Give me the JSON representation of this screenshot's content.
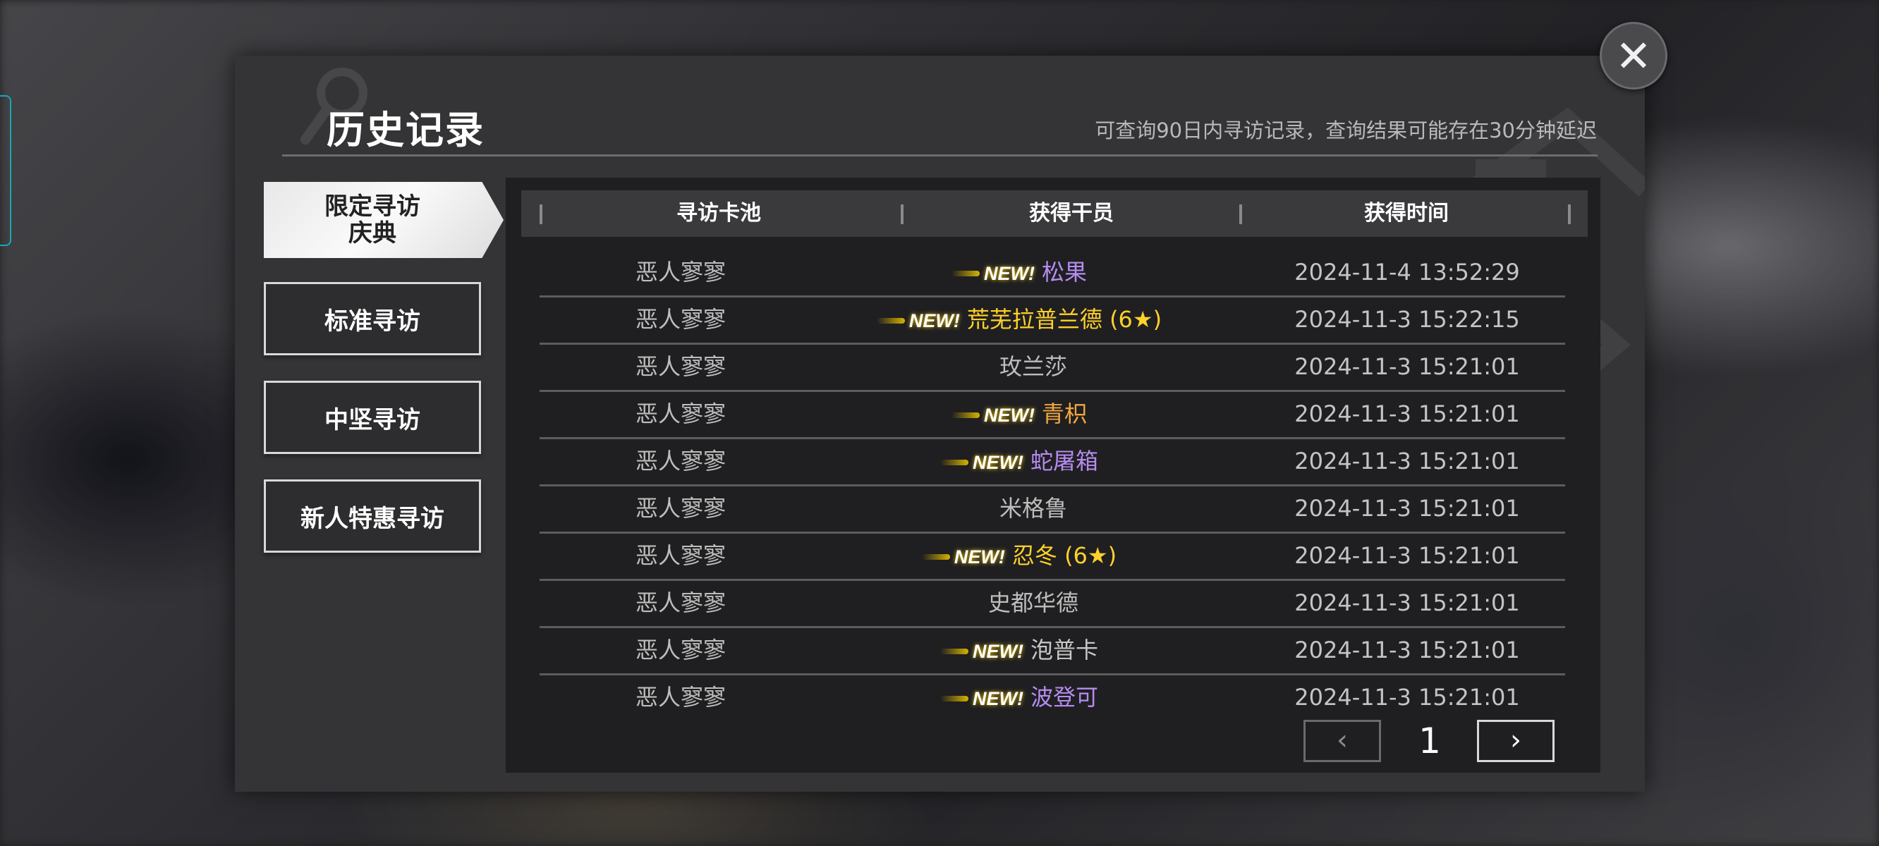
{
  "title": "历史记录",
  "subtitle": "可查询90日内寻访记录，查询结果可能存在30分钟延迟",
  "close_icon": "close-icon",
  "tabs": [
    {
      "label": "限定寻访\n庆典",
      "active": true
    },
    {
      "label": "标准寻访",
      "active": false
    },
    {
      "label": "中坚寻访",
      "active": false
    },
    {
      "label": "新人特惠寻访",
      "active": false
    }
  ],
  "table": {
    "headers": [
      "寻访卡池",
      "获得干员",
      "获得时间"
    ],
    "new_label": "NEW!",
    "rows": [
      {
        "pool": "恶人寥寥",
        "is_new": true,
        "operator": "松果",
        "color": "#b58cf0",
        "time": "2024-11-4 13:52:29"
      },
      {
        "pool": "恶人寥寥",
        "is_new": true,
        "operator": "荒芜拉普兰德 (6★)",
        "color": "#ffd12a",
        "time": "2024-11-3 15:22:15"
      },
      {
        "pool": "恶人寥寥",
        "is_new": false,
        "operator": "玫兰莎",
        "color": "#bdbdbd",
        "time": "2024-11-3 15:21:01"
      },
      {
        "pool": "恶人寥寥",
        "is_new": true,
        "operator": "青枳",
        "color": "#f2a640",
        "time": "2024-11-3 15:21:01"
      },
      {
        "pool": "恶人寥寥",
        "is_new": true,
        "operator": "蛇屠箱",
        "color": "#b58cf0",
        "time": "2024-11-3 15:21:01"
      },
      {
        "pool": "恶人寥寥",
        "is_new": false,
        "operator": "米格鲁",
        "color": "#bdbdbd",
        "time": "2024-11-3 15:21:01"
      },
      {
        "pool": "恶人寥寥",
        "is_new": true,
        "operator": "忍冬 (6★)",
        "color": "#ffd12a",
        "time": "2024-11-3 15:21:01"
      },
      {
        "pool": "恶人寥寥",
        "is_new": false,
        "operator": "史都华德",
        "color": "#bdbdbd",
        "time": "2024-11-3 15:21:01"
      },
      {
        "pool": "恶人寥寥",
        "is_new": true,
        "operator": "泡普卡",
        "color": "#c8c8c8",
        "time": "2024-11-3 15:21:01"
      },
      {
        "pool": "恶人寥寥",
        "is_new": true,
        "operator": "波登可",
        "color": "#b58cf0",
        "time": "2024-11-3 15:21:01"
      }
    ]
  },
  "pager": {
    "prev": "‹",
    "page": "1",
    "next": "›"
  }
}
